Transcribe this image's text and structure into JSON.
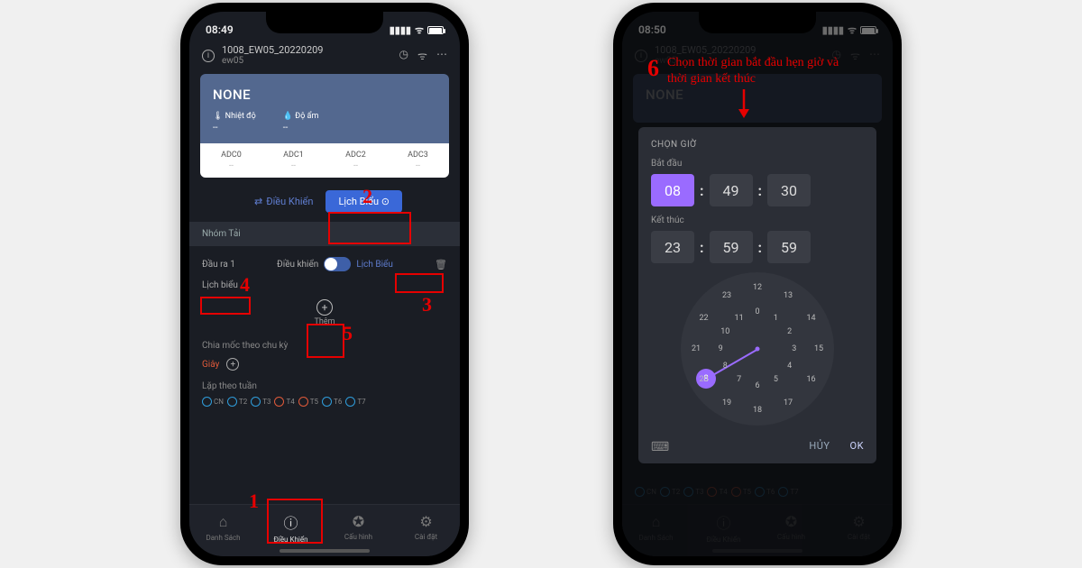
{
  "annotations": {
    "n1": "1",
    "n2": "2",
    "n3": "3",
    "n4": "4",
    "n5": "5",
    "n6": "6",
    "caption6": "Chọn thời gian bắt đầu hẹn giờ và thời gian kết thúc"
  },
  "left": {
    "status_time": "08:49",
    "device_line1": "1008_EW05_20220209",
    "device_line2": "ew05",
    "card": {
      "title": "NONE",
      "m1_label": "Nhiệt độ",
      "m1_value": "--",
      "m2_label": "Độ ẩm",
      "m2_value": "--",
      "adc": [
        "ADC0",
        "ADC1",
        "ADC2",
        "ADC3"
      ],
      "adc_val": "--"
    },
    "tabs": {
      "dieu_khien": "Điều Khiển",
      "lich_bieu": "Lịch Biểu ⊙"
    },
    "section_nhom_tai": "Nhóm Tải",
    "output": {
      "name": "Đầu ra 1",
      "mode_lbl": "Điều khiển",
      "link": "Lịch Biểu"
    },
    "sub_label": "Lịch biểu",
    "add_label": "Thêm",
    "chu_ky": "Chia mốc theo chu kỳ",
    "giay": "Giây",
    "week_label": "Lặp theo tuần",
    "days": [
      "CN",
      "T2",
      "T3",
      "T4",
      "T5",
      "T6",
      "T7"
    ],
    "day_colors": [
      "#2f9ddb",
      "#2f9ddb",
      "#2f9ddb",
      "#e05a3a",
      "#e05a3a",
      "#2f9ddb",
      "#2f9ddb"
    ],
    "nav": {
      "danh_sach": "Danh Sách",
      "dieu_khien": "Điều Khiển",
      "cau_hinh": "Cấu hình",
      "cai_dat": "Cài đặt"
    }
  },
  "right": {
    "status_time": "08:50",
    "device_line1": "1008_EW05_20220209",
    "device_line2": "ew05",
    "card_title": "NONE",
    "time_picker": {
      "title": "CHỌN GIỜ",
      "start_lbl": "Bắt đầu",
      "start": [
        "08",
        "49",
        "30"
      ],
      "end_lbl": "Kết thúc",
      "end": [
        "23",
        "59",
        "59"
      ],
      "cancel": "HỦY",
      "ok": "OK",
      "selected_hour": "8"
    },
    "days": [
      "CN",
      "T2",
      "T3",
      "T4",
      "T5",
      "T6",
      "T7"
    ],
    "nav": {
      "danh_sach": "Danh Sách",
      "dieu_khien": "Điều Khiển",
      "cau_hinh": "Cấu hình",
      "cai_dat": "Cài đặt"
    }
  }
}
